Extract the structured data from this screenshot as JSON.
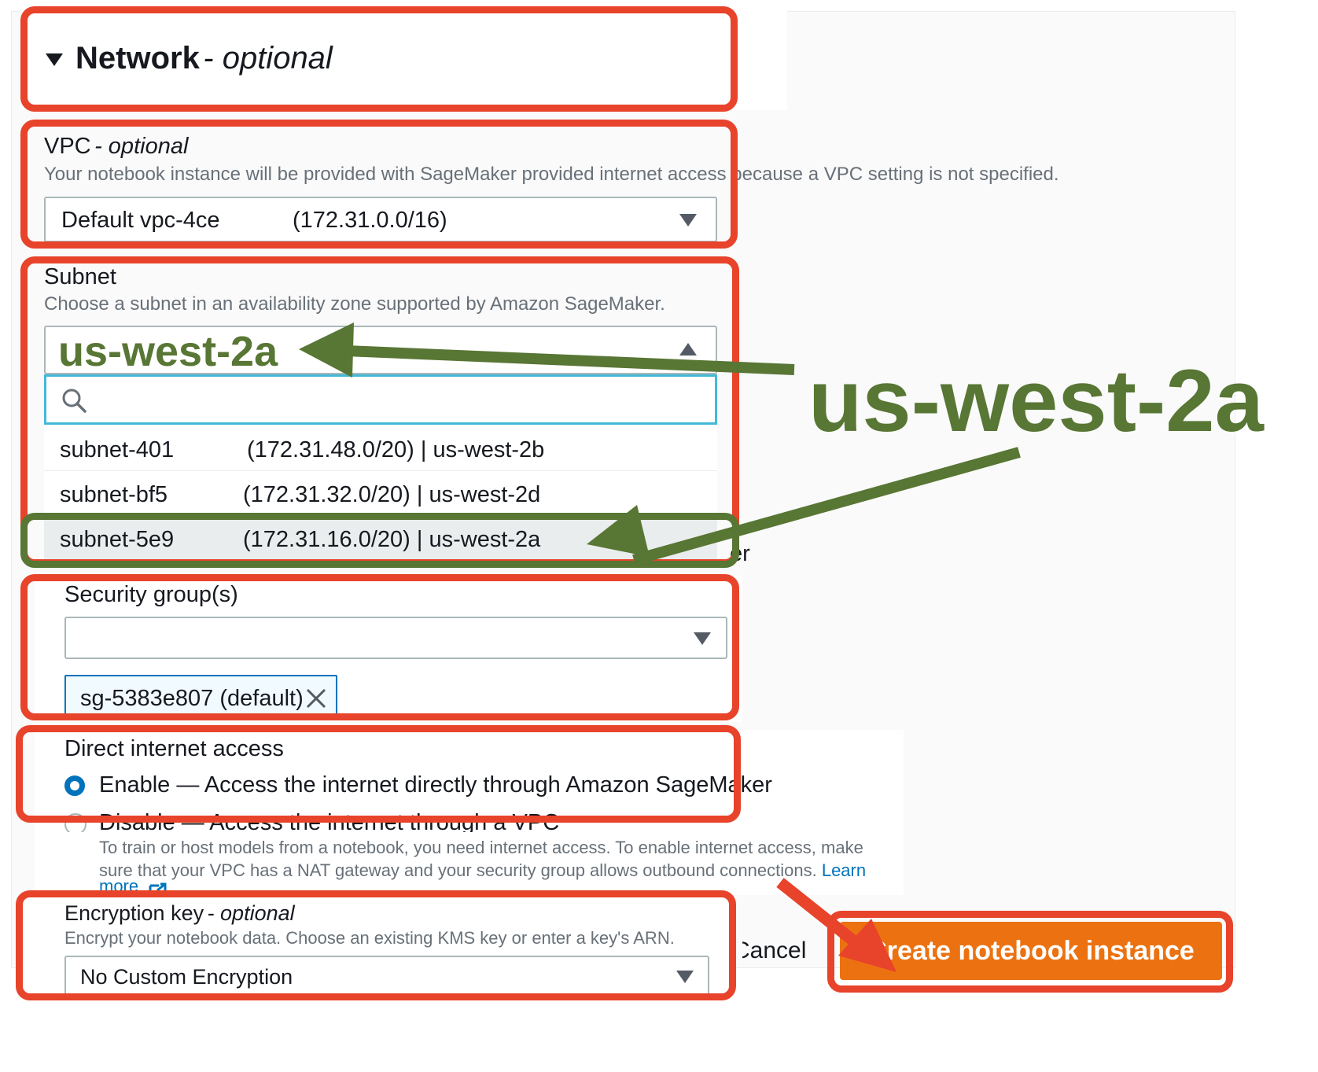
{
  "network": {
    "title": "Network",
    "title_suffix": "- optional"
  },
  "vpc": {
    "label": "VPC",
    "label_suffix": "- optional",
    "description": "Your notebook instance will be provided with SageMaker provided internet access because a VPC setting is not specified.",
    "selected_name": "Default vpc-4ce",
    "selected_cidr": "(172.31.0.0/16)"
  },
  "subnet": {
    "label": "Subnet",
    "description": "Choose a subnet in an availability zone supported by Amazon SageMaker.",
    "current_value": "us-west-2a",
    "search_placeholder": "",
    "options": [
      {
        "id": "subnet-401",
        "detail": "(172.31.48.0/20) | us-west-2b"
      },
      {
        "id": "subnet-bf5",
        "detail": "(172.31.32.0/20) | us-west-2d"
      },
      {
        "id": "subnet-5e9",
        "detail": "(172.31.16.0/20) | us-west-2a"
      }
    ],
    "behind_text_fragment": "er"
  },
  "callout": {
    "text": "us-west-2a"
  },
  "security_groups": {
    "label": "Security group(s)",
    "selected_value": "",
    "token": "sg-5383e807 (default)"
  },
  "internet_access": {
    "label": "Direct internet access",
    "enable_label": "Enable — Access the internet directly through Amazon SageMaker",
    "disable_label": "Disable — Access the internet through a VPC",
    "help_line1": "To train or host models from a notebook, you need internet access. To enable internet access, make",
    "help_line2": "sure that your VPC has a NAT gateway and your security group allows outbound connections.",
    "learn_more": "Learn",
    "learn_more_2": "more"
  },
  "encryption": {
    "label": "Encryption key",
    "label_suffix": "- optional",
    "description": "Encrypt your notebook data. Choose an existing KMS key or enter a key's ARN.",
    "selected": "No Custom Encryption"
  },
  "actions": {
    "cancel": "Cancel",
    "create": "Create notebook instance"
  },
  "colors": {
    "highlight_red": "#e8432b",
    "callout_green": "#587634",
    "primary_orange": "#ec7211",
    "link_blue": "#0073bb"
  }
}
